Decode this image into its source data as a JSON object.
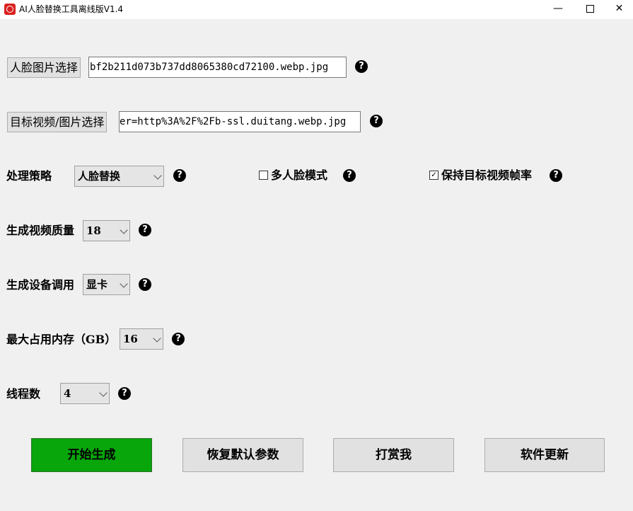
{
  "window": {
    "title": "AI人脸替换工具离线版V1.4",
    "minimize": "—",
    "close": "✕"
  },
  "face_select": {
    "button": "人脸图片选择",
    "value": "bf2b211d073b737dd8065380cd72100.webp.jpg"
  },
  "target_select": {
    "button": "目标视频/图片选择",
    "value": "er=http%3A%2F%2Fb-ssl.duitang.webp.jpg"
  },
  "strategy": {
    "label": "处理策略",
    "value": "人脸替换"
  },
  "multi_face": {
    "label": "多人脸模式",
    "checked": false
  },
  "keep_fps": {
    "label": "保持目标视频帧率",
    "checked": true,
    "mark": "✓"
  },
  "quality": {
    "label": "生成视频质量",
    "value": "18"
  },
  "device": {
    "label": "生成设备调用",
    "value": "显卡"
  },
  "memory": {
    "label": "最大占用内存（GB）",
    "value": "16"
  },
  "threads": {
    "label": "线程数",
    "value": "4"
  },
  "help_glyph": "?",
  "actions": {
    "start": "开始生成",
    "reset": "恢复默认参数",
    "reward": "打赏我",
    "update": "软件更新"
  },
  "colors": {
    "primary": "#08a60b",
    "window_bg": "#f0f0f0"
  }
}
